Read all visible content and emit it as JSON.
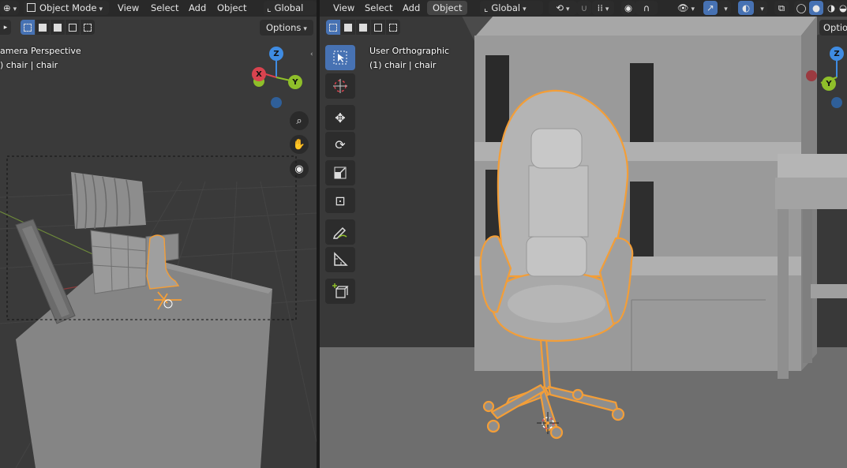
{
  "colors": {
    "selection_outline": "#f39e38",
    "active_tool": "#4772b3",
    "axis_x": "#d9434f",
    "axis_y": "#8fbf2a",
    "axis_z": "#3f8ce3"
  },
  "left_viewport": {
    "header": {
      "mode": "Object Mode",
      "menus": [
        "View",
        "Select",
        "Add",
        "Object"
      ],
      "orientation": "Global"
    },
    "options_label": "Options",
    "overlay": {
      "view_name": "amera Perspective",
      "object_info": ") chair | chair"
    },
    "gizmo": {
      "x": "X",
      "y": "Y",
      "z": "Z"
    },
    "nav_icons": [
      "zoom-icon",
      "hand-pan-icon",
      "camera-icon"
    ]
  },
  "right_viewport": {
    "header": {
      "menus": [
        "View",
        "Select",
        "Add",
        "Object"
      ],
      "active_menu": "Object",
      "orientation": "Global"
    },
    "options_label": "Optio",
    "overlay": {
      "view_name": "User Orthographic",
      "object_info": "(1) chair | chair"
    },
    "gizmo": {
      "x": "X",
      "y": "Y",
      "z": "Z"
    },
    "toolbar": [
      "select-box",
      "cursor",
      "move",
      "rotate",
      "scale",
      "transform",
      "annotate",
      "measure",
      "add-cube"
    ]
  }
}
